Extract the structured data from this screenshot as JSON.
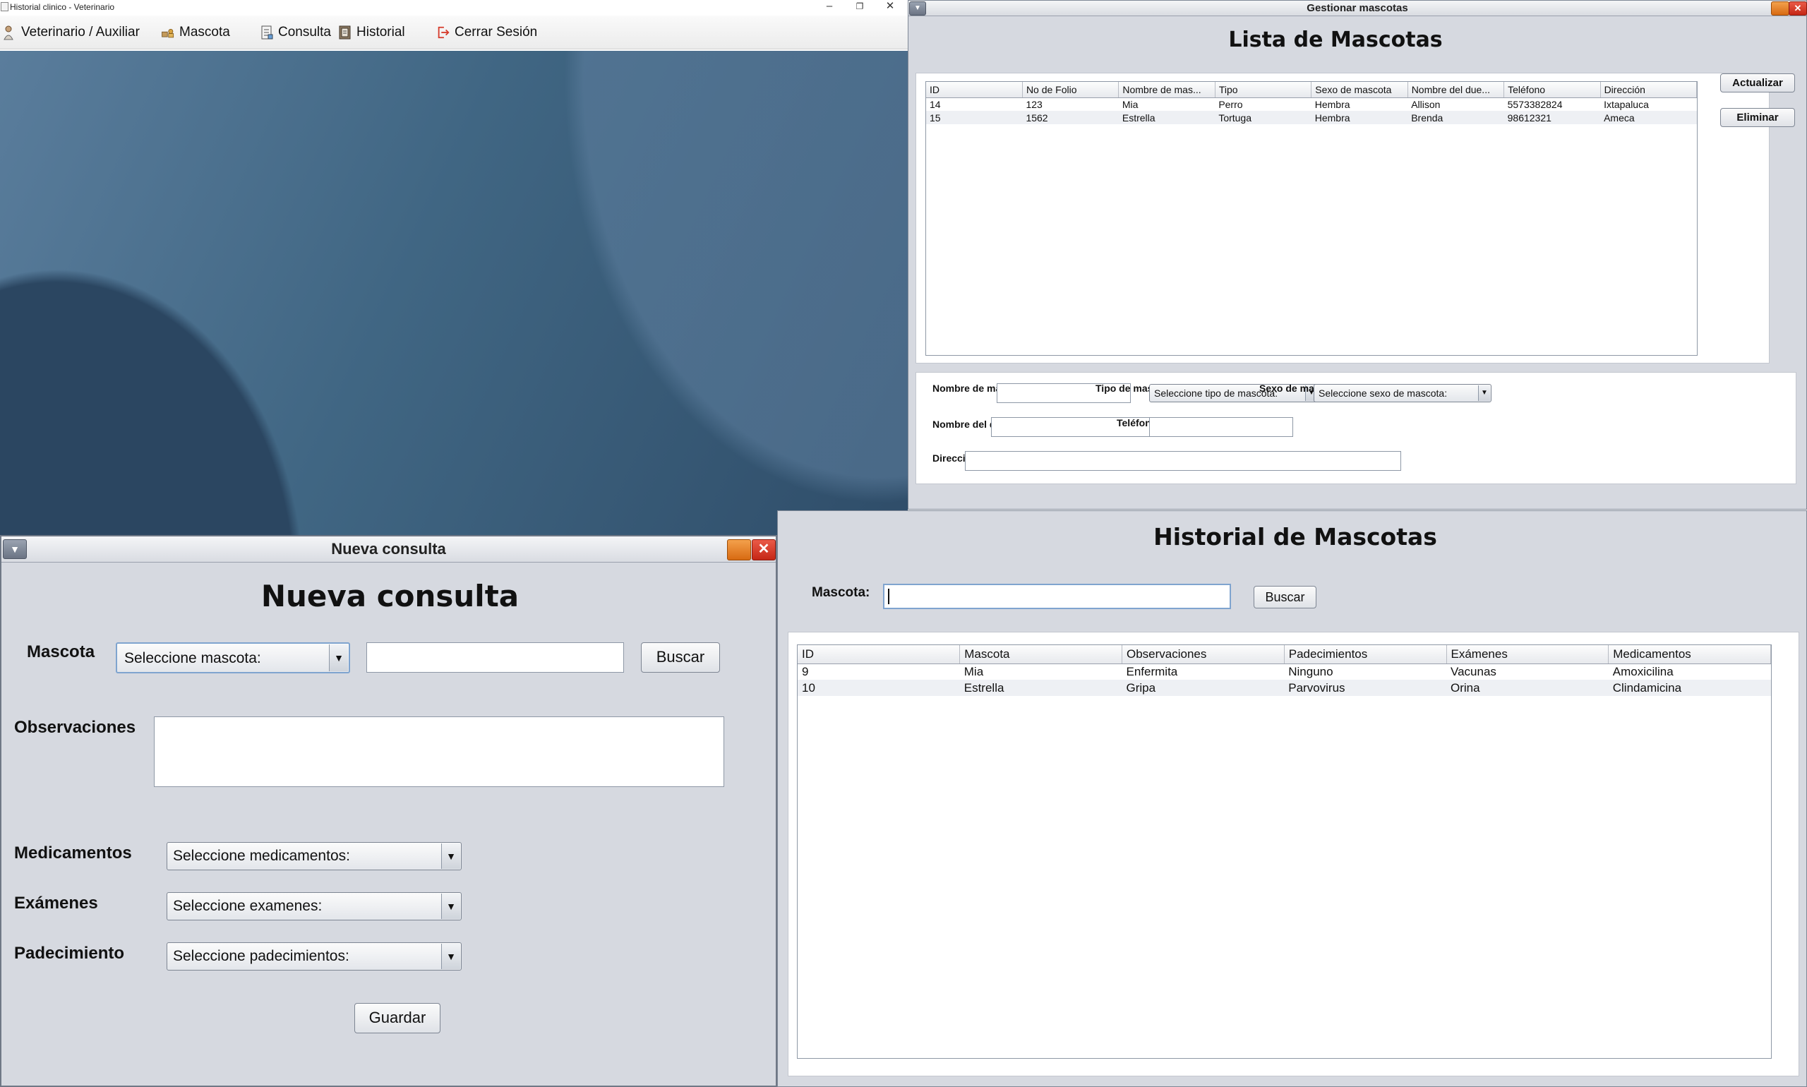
{
  "main_window": {
    "title": "Historial clinico - Veterinario",
    "controls": {
      "minimize": "–",
      "restore": "❐",
      "close": "✕"
    },
    "menu": [
      {
        "label": "Veterinario / Auxiliar",
        "icon": "user-icon"
      },
      {
        "label": "Mascota",
        "icon": "pets-icon"
      },
      {
        "label": "Consulta",
        "icon": "consult-icon"
      },
      {
        "label": "Historial",
        "icon": "history-icon"
      },
      {
        "label": "Cerrar Sesión",
        "icon": "logout-icon"
      }
    ]
  },
  "gestionar": {
    "window_title": "Gestionar mascotas",
    "heading": "Lista de Mascotas",
    "columns": [
      "ID",
      "No de Folio",
      "Nombre de mas...",
      "Tipo",
      "Sexo de mascota",
      "Nombre del due...",
      "Teléfono",
      "Dirección"
    ],
    "rows": [
      [
        "14",
        "123",
        "Mia",
        "Perro",
        "Hembra",
        "Allison",
        "5573382824",
        "Ixtapaluca"
      ],
      [
        "15",
        "1562",
        "Estrella",
        "Tortuga",
        "Hembra",
        "Brenda",
        "98612321",
        "Ameca"
      ]
    ],
    "actualizar_label": "Actualizar",
    "eliminar_label": "Eliminar",
    "form": {
      "nombre_label": "Nombre de mascota",
      "tipo_label": "Tipo de mascota",
      "tipo_value": "Seleccione tipo de mascota:",
      "sexo_label": "Sexo de mascota",
      "sexo_value": "Seleccione sexo de mascota:",
      "dueno_label": "Nombre del dueño",
      "telefono_label": "Teléfono",
      "direccion_label": "Dirección"
    }
  },
  "historial": {
    "heading": "Historial de Mascotas",
    "mascota_label": "Mascota:",
    "search_value": "",
    "buscar_label": "Buscar",
    "columns": [
      "ID",
      "Mascota",
      "Observaciones",
      "Padecimientos",
      "Exámenes",
      "Medicamentos"
    ],
    "rows": [
      [
        "9",
        "Mia",
        "Enfermita",
        "Ninguno",
        "Vacunas",
        "Amoxicilina"
      ],
      [
        "10",
        "Estrella",
        "Gripa",
        "Parvovirus",
        "Orina",
        "Clindamicina"
      ]
    ]
  },
  "nueva": {
    "window_title": "Nueva consulta",
    "heading": "Nueva consulta",
    "mascota_label": "Mascota",
    "mascota_select": "Seleccione mascota:",
    "buscar_label": "Buscar",
    "observaciones_label": "Observaciones",
    "medicamentos_label": "Medicamentos",
    "medicamentos_select": "Seleccione medicamentos:",
    "examenes_label": "Exámenes",
    "examenes_select": "Seleccione examenes:",
    "padecimiento_label": "Padecimiento",
    "padecimiento_select": "Seleccione padecimientos:",
    "guardar_label": "Guardar"
  }
}
